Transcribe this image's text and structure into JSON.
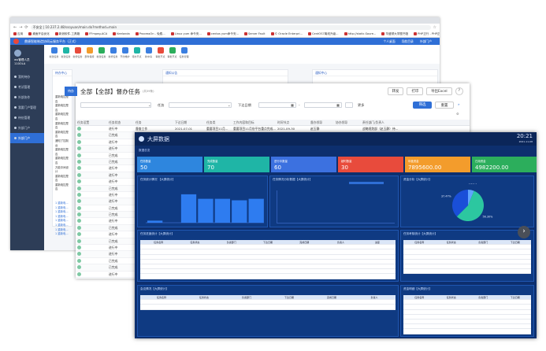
{
  "browser": {
    "warning": "不安全",
    "url": "10.237.2.48/ssoyuan/main.do?method=main",
    "bookmarks": [
      "应用",
      "桌面开启优化",
      "新浪软件-工具箱",
      "FFmpeg-ACA",
      "Keelonda",
      "ProcessOn - 免费...",
      "Linux yum 命令安...",
      "centos yum命令安...",
      "Server Fault",
      "© Oracle Enterpri...",
      "CentOS7离线升级...",
      "http://static.Soure...",
      "华盛顿大学图书馆",
      "PHP正行 - PHP正行..."
    ],
    "reading_list": "阅读清单"
  },
  "app": {
    "title": "鼎捷智能制造协同云服务平台（正式）",
    "top_links": [
      "个人桌面",
      "导航目录",
      "外部门户"
    ],
    "user": {
      "name": "wu管理人员",
      "id": "110OLA"
    },
    "sidebar": [
      "我的待办",
      "考试管理",
      "外部协作",
      "我要门户管理",
      "待处管理",
      "外部门户",
      "外部门户"
    ],
    "sidebar_active": 6,
    "shortcuts": [
      "新建任务",
      "新建任务",
      "新增任务",
      "部件保持",
      "新建任务",
      "新增任务",
      "节约维护",
      "待办节点",
      "新中请",
      "审批节点",
      "审批节点",
      "任务管理"
    ],
    "panel_titles": [
      "待办中心",
      "通知公告",
      "通知中心",
      "常用功能"
    ],
    "mini_list": [
      "重新电控是否",
      "重新电控是否",
      "重新电控是否",
      "重新电控是否",
      "重新电控是否",
      "通知了控制台",
      "重新电控是否",
      "重新电控是否",
      "万能中间设计",
      "重新电控是否",
      "重新电控是否"
    ],
    "mini_list2": [
      "1 重新电...",
      "1 重新电...",
      "1 重新电...",
      "1 重新电...",
      "1 重新电...",
      "1 重新电...",
      "1 重新电...",
      "1 重新电..."
    ]
  },
  "task_window": {
    "left_tab": "待办",
    "title": "全部【全部】督办任务",
    "subtitle": "(共59条)",
    "actions": [
      "转发",
      "打印",
      "导出Excel",
      "?"
    ],
    "filters": {
      "label_dept": "部门",
      "label_task": "任务",
      "label_due": "下达日期",
      "label_more": "更多",
      "range_sep": "-"
    },
    "query_button": "筛选",
    "reset_button": "重置",
    "columns": [
      "任务设置",
      "任务状态",
      "任务",
      "下达日期",
      "任务类",
      "工作内容和目标",
      "时间节点",
      "督办领导",
      "协办领导",
      "责任部门/负责人"
    ],
    "rows": [
      [
        "",
        "进行中",
        "督查工作",
        "2021-07-01",
        "重要项目11月...",
        "重要项目11月份平台重点完成...",
        "2021-09-30",
        "赵玉静",
        "",
        "战略规划部（赵玉静）待..."
      ],
      [
        "",
        "已完成",
        "",
        "",
        "",
        "",
        "",
        "",
        "",
        ""
      ],
      [
        "",
        "进行中",
        "",
        "",
        "",
        "",
        "",
        "",
        "",
        ""
      ],
      [
        "",
        "进行中",
        "",
        "",
        "",
        "",
        "",
        "",
        "",
        ""
      ],
      [
        "",
        "已完成",
        "",
        "",
        "",
        "",
        "",
        "",
        "",
        ""
      ],
      [
        "",
        "已完成",
        "",
        "",
        "",
        "",
        "",
        "",
        "",
        ""
      ],
      [
        "",
        "进行中",
        "",
        "",
        "",
        "",
        "",
        "",
        "",
        ""
      ],
      [
        "",
        "进行中",
        "",
        "",
        "",
        "",
        "",
        "",
        "",
        ""
      ],
      [
        "",
        "进行中",
        "",
        "",
        "",
        "",
        "",
        "",
        "",
        ""
      ],
      [
        "",
        "已完成",
        "",
        "",
        "",
        "",
        "",
        "",
        "",
        ""
      ],
      [
        "",
        "进行中",
        "",
        "",
        "",
        "",
        "",
        "",
        "",
        ""
      ],
      [
        "",
        "进行中",
        "",
        "",
        "",
        "",
        "",
        "",
        "",
        ""
      ],
      [
        "",
        "已完成",
        "",
        "",
        "",
        "",
        "",
        "",
        "",
        ""
      ],
      [
        "",
        "已完成",
        "",
        "",
        "",
        "",
        "",
        "",
        "",
        ""
      ],
      [
        "",
        "进行中",
        "",
        "",
        "",
        "",
        "",
        "",
        "",
        ""
      ],
      [
        "",
        "已完成",
        "",
        "",
        "",
        "",
        "",
        "",
        "",
        ""
      ],
      [
        "",
        "进行中",
        "",
        "",
        "",
        "",
        "",
        "",
        "",
        ""
      ],
      [
        "",
        "已完成",
        "",
        "",
        "",
        "",
        "",
        "",
        "",
        ""
      ],
      [
        "",
        "进行中",
        "",
        "",
        "",
        "",
        "",
        "",
        "",
        ""
      ],
      [
        "",
        "进行中",
        "",
        "",
        "",
        "",
        "",
        "",
        "",
        ""
      ],
      [
        "",
        "已完成",
        "",
        "",
        "",
        "",
        "",
        "",
        "",
        ""
      ],
      [
        "",
        "已完成",
        "",
        "",
        "",
        "",
        "",
        "",
        "",
        ""
      ],
      [
        "",
        "进行中",
        "",
        "",
        "",
        "",
        "",
        "",
        "",
        ""
      ],
      [
        "",
        "进行中",
        "",
        "",
        "",
        "",
        "",
        "",
        "",
        ""
      ]
    ]
  },
  "dashboard": {
    "title": "大屏数据",
    "time": "20:21",
    "date": "2021-11-08",
    "section": "数据总览",
    "cards": [
      {
        "label": "任务数量",
        "value": "50",
        "color": "#2e86de"
      },
      {
        "label": "完成数量",
        "value": "70",
        "color": "#1fb5a6"
      },
      {
        "label": "进行中数量",
        "value": "60",
        "color": "#3c71e0"
      },
      {
        "label": "超时数量",
        "value": "30",
        "color": "#e84b3c"
      },
      {
        "label": "年度资金",
        "value": "7895600.00",
        "color": "#f39c2c"
      },
      {
        "label": "已用资金",
        "value": "4982200.00",
        "color": "#2cae5c"
      }
    ],
    "box_titles": [
      "任务统计情况 【大屏统计】",
      "任务情况分析数据【大屏统计】",
      "资金分析【大屏统计】",
      "任务进度统计【大屏统计】",
      "任务考核统计【大屏统计】",
      "会议情况【大屏统计】",
      "资金明细【大屏统计】"
    ],
    "table_headers": [
      "任务名称",
      "任务状态",
      "负责部门",
      "下达日期",
      "完成日期",
      "负责人",
      "进度"
    ],
    "pie_labels": [
      "6.23%",
      "56.30%",
      "37.47%"
    ]
  },
  "chart_data": [
    {
      "type": "bar",
      "categories": [
        "1",
        "2",
        "3",
        "4",
        "5",
        "6",
        "7"
      ],
      "series": [
        {
          "values": [
            7,
            0,
            95,
            80,
            80,
            75,
            80
          ]
        }
      ],
      "ylim": [
        0,
        100
      ]
    },
    {
      "type": "pie",
      "labels": [
        "6.23%",
        "56.30%",
        "37.47%"
      ],
      "values": [
        6.23,
        56.3,
        37.47
      ],
      "colors": [
        "#5fa5ff",
        "#2cc7a0",
        "#1a4fd8"
      ]
    }
  ]
}
